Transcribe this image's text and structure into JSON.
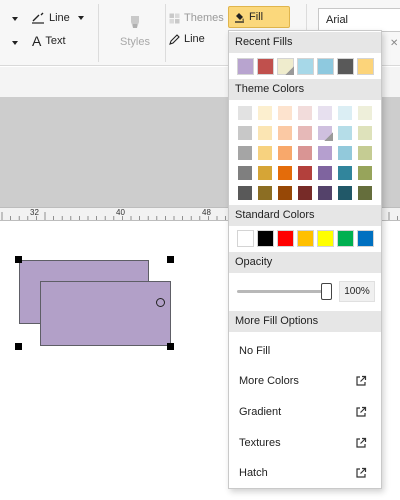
{
  "toolbar": {
    "line_label": "Line",
    "text_label": "Text",
    "styles_label": "Styles",
    "themes_label": "Themes",
    "line2_label": "Line",
    "fill_label": "Fill",
    "font_value": "Arial",
    "close_glyph": "✕"
  },
  "ruler": {
    "labels": [
      "32",
      "40",
      "48"
    ]
  },
  "fill_menu": {
    "recent_title": "Recent Fills",
    "recent_colors": [
      "#b8a4cf",
      "#c0504d",
      "#efeccd",
      "#a7d8e8",
      "#8ec9df",
      "#595959",
      "#fcd47a"
    ],
    "theme_title": "Theme Colors",
    "theme_colors": [
      [
        "#e2e2e2",
        "#fcefcf",
        "#fde3ce",
        "#f2dcdb",
        "#e7e0ef",
        "#dbeef4",
        "#eeefda"
      ],
      [
        "#c8c8c8",
        "#fbe5b3",
        "#fbc9a4",
        "#e6b9b8",
        "#cfc0df",
        "#b5dde8",
        "#dee2bb"
      ],
      [
        "#a5a5a5",
        "#f7d27f",
        "#f8a86b",
        "#d99594",
        "#b59fcf",
        "#92c9db",
        "#c5cc93"
      ],
      [
        "#7f7f7f",
        "#d6a536",
        "#e46c0a",
        "#b3403c",
        "#7f649f",
        "#31859c",
        "#97a45b"
      ],
      [
        "#595959",
        "#8c6e23",
        "#974806",
        "#772b28",
        "#54426a",
        "#215868",
        "#656e3c"
      ]
    ],
    "standard_title": "Standard Colors",
    "standard_colors": [
      "#ffffff",
      "#000000",
      "#ff0000",
      "#ffc000",
      "#ffff00",
      "#00b050",
      "#0070c0"
    ],
    "opacity_title": "Opacity",
    "opacity_value": "100%",
    "opacity_level": 1.0,
    "more_title": "More Fill Options",
    "options": [
      {
        "label": "No Fill",
        "external": false
      },
      {
        "label": "More Colors",
        "external": true
      },
      {
        "label": "Gradient",
        "external": true
      },
      {
        "label": "Textures",
        "external": true
      },
      {
        "label": "Hatch",
        "external": true
      }
    ]
  },
  "colors": {
    "accent": "#fbd87c",
    "shape_fill": "#b2a0c8",
    "canvas_grey": "#cdcdcd"
  }
}
